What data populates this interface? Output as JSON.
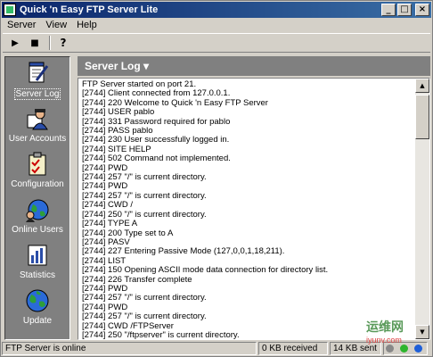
{
  "window": {
    "title": "Quick 'n Easy FTP Server Lite"
  },
  "titlebar": {
    "minimize": "_",
    "maximize": "□",
    "close": "×"
  },
  "menu": [
    {
      "label": "Server"
    },
    {
      "label": "View"
    },
    {
      "label": "Help"
    }
  ],
  "toolbar": {
    "start": "▶",
    "stop": "■",
    "help": "?"
  },
  "sidebar": [
    {
      "label": "Server Log",
      "icon": "notepad-pencil-icon",
      "active": true
    },
    {
      "label": "User Accounts",
      "icon": "user-accounts-icon",
      "active": false
    },
    {
      "label": "Configuration",
      "icon": "checklist-icon",
      "active": false
    },
    {
      "label": "Online Users",
      "icon": "globe-users-icon",
      "active": false
    },
    {
      "label": "Statistics",
      "icon": "bar-chart-icon",
      "active": false
    },
    {
      "label": "Update",
      "icon": "globe-icon",
      "active": false
    }
  ],
  "panel": {
    "title": "Server Log ▾"
  },
  "log": [
    "FTP Server started on port 21.",
    "[2744] Client connected from 127.0.0.1.",
    "[2744] 220 Welcome to Quick 'n Easy FTP Server",
    "[2744] USER pablo",
    "[2744] 331 Password required for pablo",
    "[2744] PASS pablo",
    "[2744] 230 User successfully logged in.",
    "[2744] SITE HELP",
    "[2744] 502 Command not implemented.",
    "[2744] PWD",
    "[2744] 257 \"/\" is current directory.",
    "[2744] PWD",
    "[2744] 257 \"/\" is current directory.",
    "[2744] CWD /",
    "[2744] 250 \"/\" is current directory.",
    "[2744] TYPE A",
    "[2744] 200 Type set to A",
    "[2744] PASV",
    "[2744] 227 Entering Passive Mode (127,0,0,1,18,211).",
    "[2744] LIST",
    "[2744] 150 Opening ASCII mode data connection for directory list.",
    "[2744] 226 Transfer complete",
    "[2744] PWD",
    "[2744] 257 \"/\" is current directory.",
    "[2744] PWD",
    "[2744] 257 \"/\" is current directory.",
    "[2744] CWD /FTPServer",
    "[2744] 250 \"/ftpserver\" is current directory."
  ],
  "status": {
    "text": "FTP Server is online",
    "received": "0 KB received",
    "sent": "14 KB sent"
  },
  "watermark": {
    "cn": "运维网",
    "url": "iyunv.com"
  }
}
